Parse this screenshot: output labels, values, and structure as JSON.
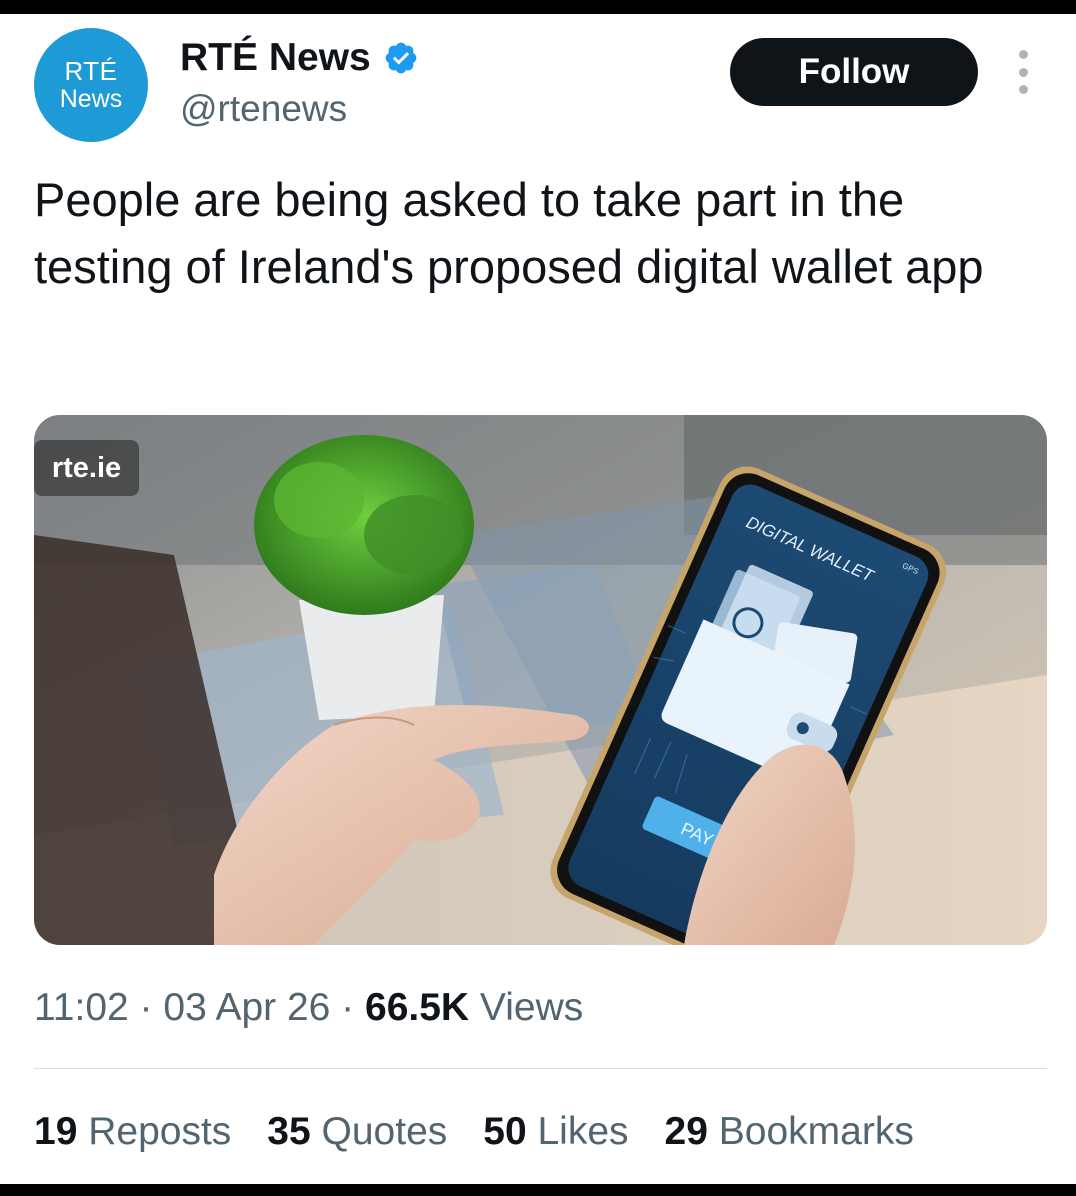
{
  "author": {
    "avatar_line1": "RTÉ",
    "avatar_line2": "News",
    "display_name": "RTÉ News",
    "handle": "@rtenews",
    "verified_icon": "verified-badge-icon"
  },
  "actions": {
    "follow_label": "Follow",
    "more_icon": "more-vertical-icon"
  },
  "tweet": {
    "text": "People are being asked to take part in the testing of Ireland's proposed digital wallet app"
  },
  "media": {
    "source_badge": "rte.ie",
    "screen_title": "DIGITAL WALLET",
    "screen_status": "GPS",
    "screen_button": "PAY"
  },
  "meta": {
    "time": "11:02",
    "sep1": " · ",
    "date": "03 Apr 26",
    "sep2": " · ",
    "views_count": "66.5K",
    "views_label": " Views"
  },
  "stats": {
    "reposts_count": "19",
    "reposts_label": " Reposts",
    "quotes_count": "35",
    "quotes_label": " Quotes",
    "likes_count": "50",
    "likes_label": " Likes",
    "bookmarks_count": "29",
    "bookmarks_label": " Bookmarks"
  },
  "colors": {
    "brand": "#1e9ad6",
    "verified": "#1d9bf0",
    "text": "#0f1419",
    "muted": "#536471"
  }
}
